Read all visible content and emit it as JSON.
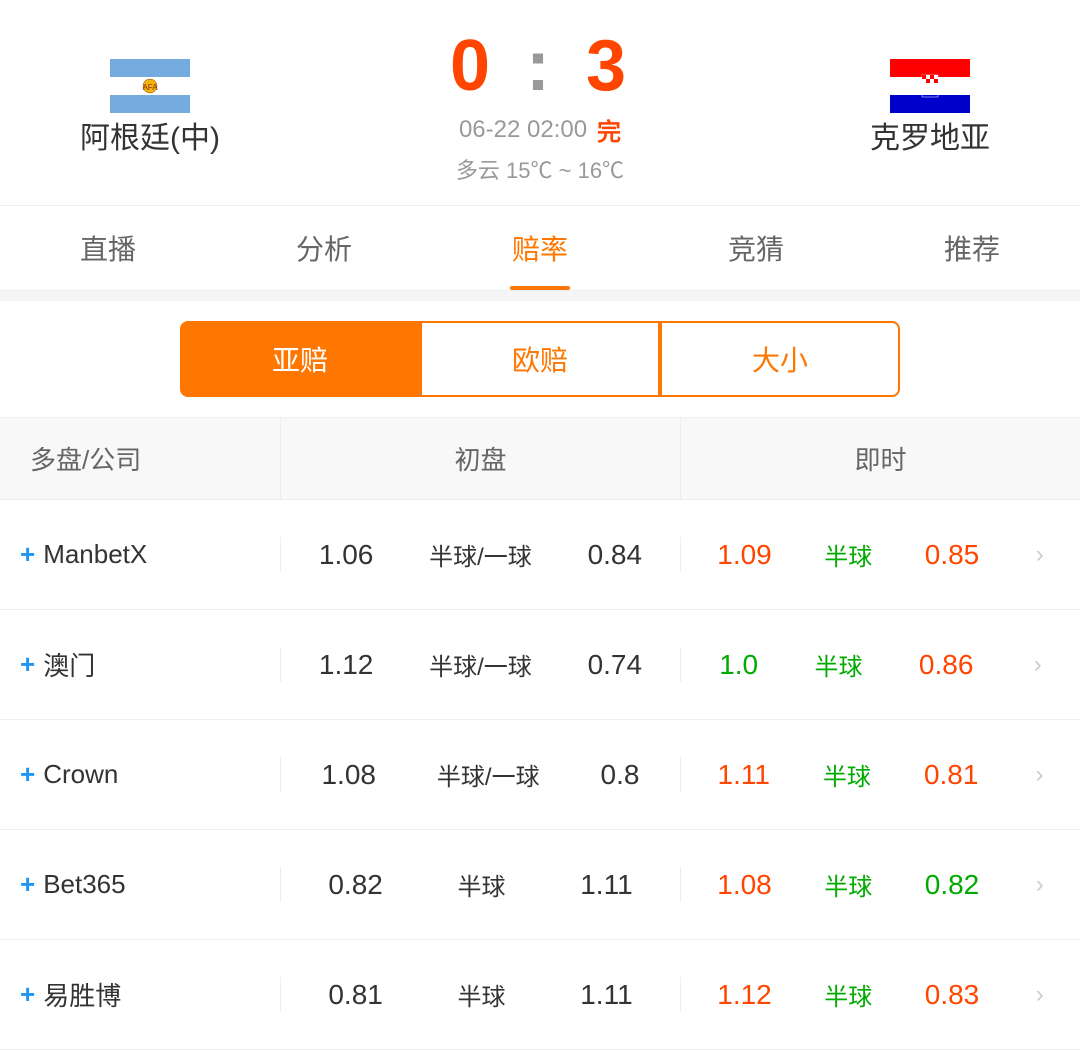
{
  "match": {
    "team_left": "阿根廷(中)",
    "team_right": "克罗地亚",
    "score": "0 : 3",
    "score_left": "0",
    "score_colon": ":",
    "score_right": "3",
    "date": "06-22 02:00",
    "status": "完",
    "weather": "多云  15℃ ~ 16℃"
  },
  "tabs": [
    {
      "label": "直播",
      "active": false
    },
    {
      "label": "分析",
      "active": false
    },
    {
      "label": "赔率",
      "active": true
    },
    {
      "label": "竞猜",
      "active": false
    },
    {
      "label": "推荐",
      "active": false
    }
  ],
  "sub_tabs": [
    {
      "label": "亚赔",
      "active": true
    },
    {
      "label": "欧赔",
      "active": false
    },
    {
      "label": "大小",
      "active": false
    }
  ],
  "table": {
    "headers": {
      "company": "多盘/公司",
      "initial": "初盘",
      "realtime": "即时"
    },
    "rows": [
      {
        "company": "ManbetX",
        "initial_left": "1.06",
        "initial_mid": "半球/一球",
        "initial_right": "0.84",
        "rt_left": "1.09",
        "rt_left_color": "red",
        "rt_mid": "半球",
        "rt_mid_color": "green",
        "rt_right": "0.85",
        "rt_right_color": "red"
      },
      {
        "company": "澳门",
        "initial_left": "1.12",
        "initial_mid": "半球/一球",
        "initial_right": "0.74",
        "rt_left": "1.0",
        "rt_left_color": "green",
        "rt_mid": "半球",
        "rt_mid_color": "green",
        "rt_right": "0.86",
        "rt_right_color": "red"
      },
      {
        "company": "Crown",
        "initial_left": "1.08",
        "initial_mid": "半球/一球",
        "initial_right": "0.8",
        "rt_left": "1.11",
        "rt_left_color": "red",
        "rt_mid": "半球",
        "rt_mid_color": "green",
        "rt_right": "0.81",
        "rt_right_color": "red"
      },
      {
        "company": "Bet365",
        "initial_left": "0.82",
        "initial_mid": "半球",
        "initial_right": "1.11",
        "rt_left": "1.08",
        "rt_left_color": "red",
        "rt_mid": "半球",
        "rt_mid_color": "green",
        "rt_right": "0.82",
        "rt_right_color": "green"
      },
      {
        "company": "易胜博",
        "initial_left": "0.81",
        "initial_mid": "半球",
        "initial_right": "1.11",
        "rt_left": "1.12",
        "rt_left_color": "red",
        "rt_mid": "半球",
        "rt_mid_color": "green",
        "rt_right": "0.83",
        "rt_right_color": "red"
      }
    ]
  },
  "icons": {
    "plus": "+",
    "arrow": "›"
  }
}
